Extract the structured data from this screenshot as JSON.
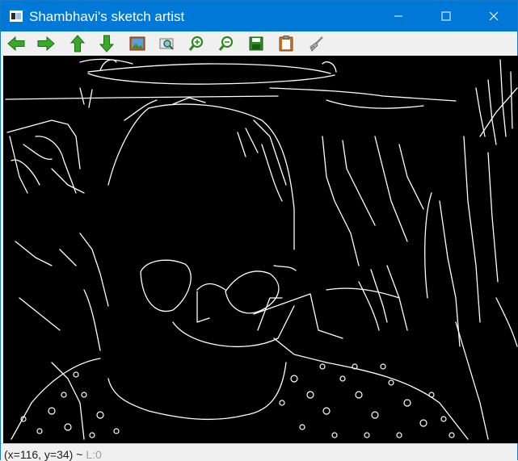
{
  "window": {
    "title": "Shambhavi's sketch artist",
    "controls": {
      "minimize_icon": "minimize-icon",
      "maximize_icon": "maximize-icon",
      "close_icon": "close-icon"
    }
  },
  "toolbar": {
    "buttons": [
      {
        "name": "pan-left",
        "icon": "arrow-left-icon"
      },
      {
        "name": "pan-right",
        "icon": "arrow-right-icon"
      },
      {
        "name": "pan-up",
        "icon": "arrow-up-icon"
      },
      {
        "name": "pan-down",
        "icon": "arrow-down-icon"
      },
      {
        "name": "zoom-image",
        "icon": "image-icon"
      },
      {
        "name": "zoom-fit",
        "icon": "zoom-fit-icon"
      },
      {
        "name": "zoom-in",
        "icon": "zoom-in-icon"
      },
      {
        "name": "zoom-out",
        "icon": "zoom-out-icon"
      },
      {
        "name": "save",
        "icon": "save-icon"
      },
      {
        "name": "copy",
        "icon": "clipboard-icon"
      },
      {
        "name": "properties",
        "icon": "brush-icon"
      }
    ]
  },
  "status": {
    "coords": "(x=116, y=34) ~ ",
    "pixel": "L:0"
  },
  "colors": {
    "titlebar": "#0078d7",
    "toolbar_icon_green": "#2e9e1f",
    "canvas_bg": "#000000",
    "sketch_lines": "#ffffff"
  }
}
